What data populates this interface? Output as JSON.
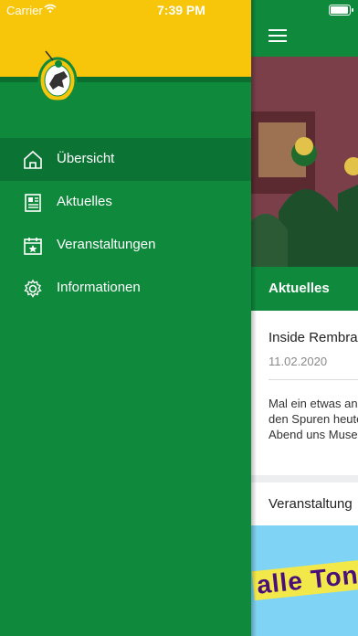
{
  "status_bar": {
    "carrier": "Carrier",
    "time": "7:39 PM"
  },
  "drawer": {
    "colors": {
      "yellow": "#f7c50a",
      "green": "#0f8a3c"
    },
    "menu": [
      {
        "label": "Übersicht",
        "icon": "home-icon",
        "active": true
      },
      {
        "label": "Aktuelles",
        "icon": "news-icon",
        "active": false
      },
      {
        "label": "Veranstaltungen",
        "icon": "calendar-star-icon",
        "active": false
      },
      {
        "label": "Informationen",
        "icon": "gear-icon",
        "active": false
      }
    ]
  },
  "main": {
    "section_title": "Aktuelles",
    "article": {
      "title": "Inside Rembran",
      "date": "11.02.2020",
      "text": "Mal ein etwas an Auf den Spuren heute Abend uns Museum."
    },
    "events_title": "Veranstaltung",
    "poster_text": "alle Ton"
  }
}
